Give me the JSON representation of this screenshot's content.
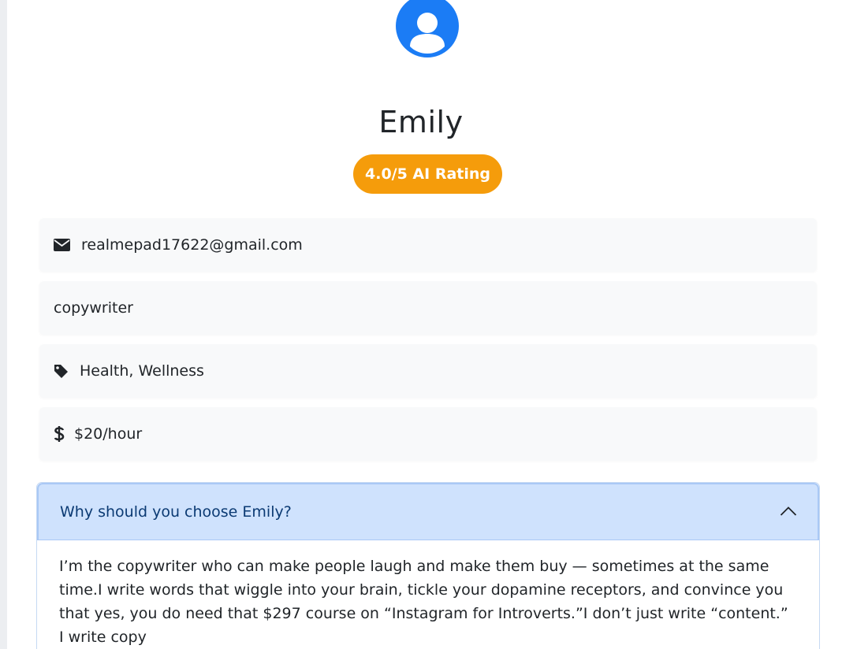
{
  "profile": {
    "name": "Emily",
    "rating_label": "4.0/5 AI Rating"
  },
  "details": {
    "email": "realmepad17622@gmail.com",
    "profession": "copywriter",
    "tags": "Health, Wellness",
    "rate": "$20/hour"
  },
  "accordion": {
    "title": "Why should you choose Emily?",
    "expanded": true,
    "body": "I’m the copywriter who can make people laugh and make them buy — sometimes at the same time.I write words that wiggle into your brain, tickle your dopamine receptors, and convince you that yes, you do need that $297 course on “Instagram for Introverts.”I don’t just write “content.” I write copy"
  },
  "colors": {
    "avatar": "#1b7cf5",
    "rating_badge": "#f59c0b",
    "accordion_header": "#cfe2fd",
    "accordion_title": "#0b3a73"
  },
  "icons": {
    "avatar": "user-circle-icon",
    "email": "envelope-icon",
    "tags": "tag-icon",
    "rate": "dollar-icon",
    "toggle": "chevron-up-icon"
  }
}
